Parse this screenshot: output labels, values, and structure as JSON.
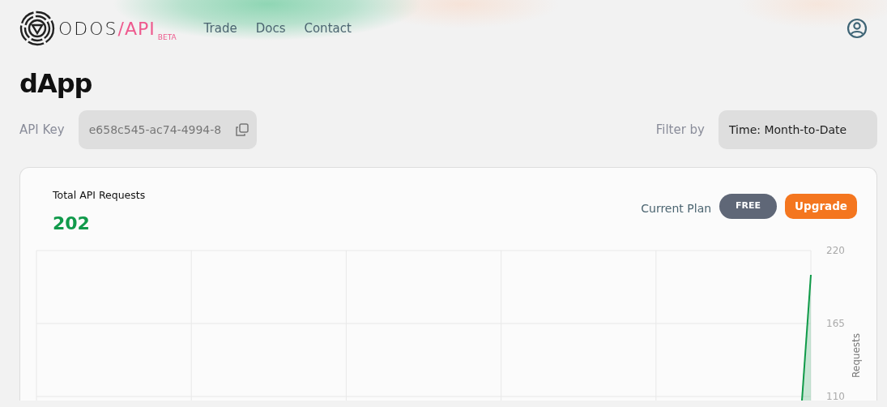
{
  "header": {
    "logo_text": "ODOS",
    "logo_suffix": "/API",
    "logo_badge": "BETA",
    "nav": [
      {
        "label": "Trade"
      },
      {
        "label": "Docs"
      },
      {
        "label": "Contact"
      }
    ]
  },
  "page_title": "dApp",
  "api_key": {
    "label": "API Key",
    "value": "e658c545-ac74-4994-8"
  },
  "filter": {
    "label": "Filter by",
    "value": "Time: Month-to-Date"
  },
  "usage": {
    "title": "Total API Requests",
    "total": "202",
    "plan_label": "Current Plan",
    "plan": "FREE",
    "upgrade": "Upgrade",
    "chart": {
      "y_ticks": [
        "220",
        "165",
        "110"
      ],
      "y_axis_title": "Requests"
    }
  }
}
